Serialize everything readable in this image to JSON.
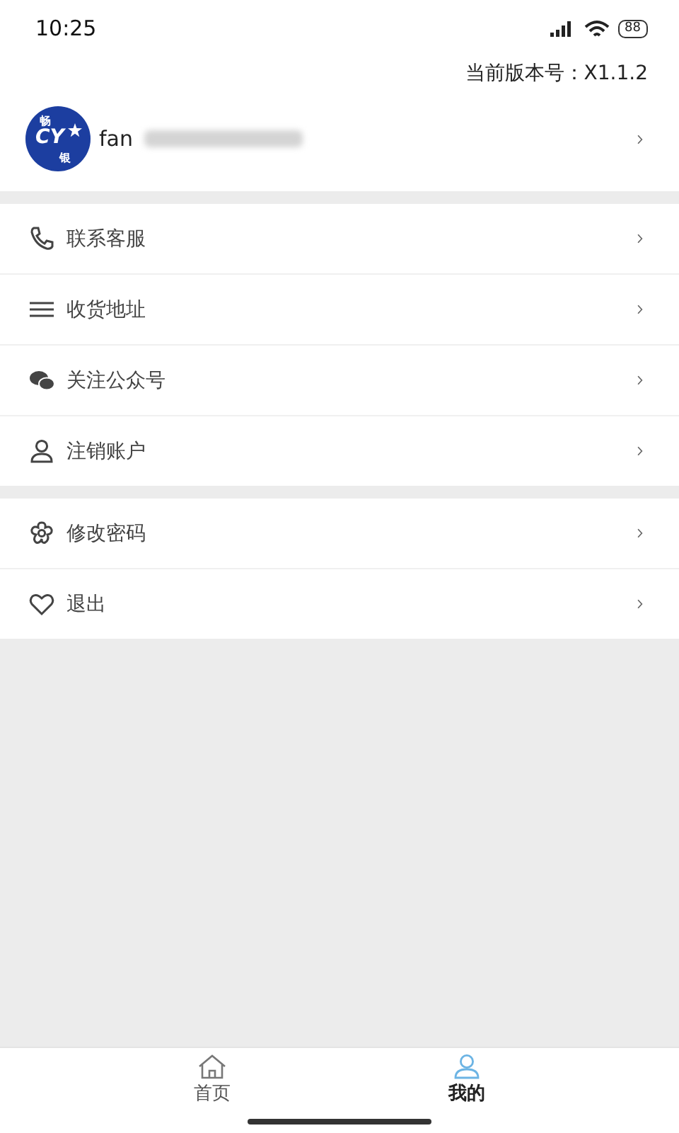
{
  "status_bar": {
    "time": "10:25",
    "battery": "88"
  },
  "version": {
    "label": "当前版本号：X1.1.2"
  },
  "profile": {
    "logo": {
      "top": "畅",
      "main": "CY",
      "bottom": "银"
    },
    "name": "fan"
  },
  "menu_groups": [
    {
      "items": [
        {
          "label": "联系客服"
        },
        {
          "label": "收货地址"
        },
        {
          "label": "关注公众号"
        },
        {
          "label": "注销账户"
        }
      ]
    },
    {
      "items": [
        {
          "label": "修改密码"
        },
        {
          "label": "退出"
        }
      ]
    }
  ],
  "tab_bar": [
    {
      "label": "首页",
      "selected": false
    },
    {
      "label": "我的",
      "selected": true
    }
  ]
}
